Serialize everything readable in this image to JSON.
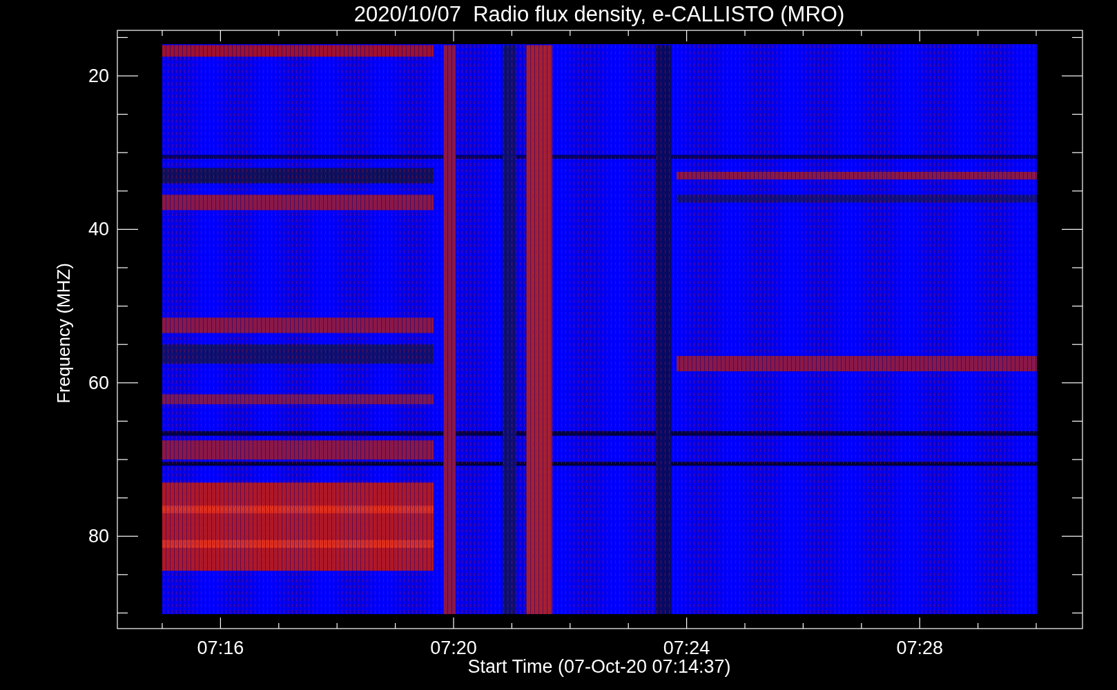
{
  "title": "2020/10/07  Radio flux density, e-CALLISTO (MRO)",
  "y_axis": {
    "label": "Frequency (MHZ)",
    "ticks": [
      "20",
      "40",
      "60",
      "80"
    ]
  },
  "x_axis": {
    "label": "Start Time (07-Oct-20 07:14:37)",
    "ticks": [
      "07:16",
      "07:20",
      "07:24",
      "07:28"
    ]
  }
}
